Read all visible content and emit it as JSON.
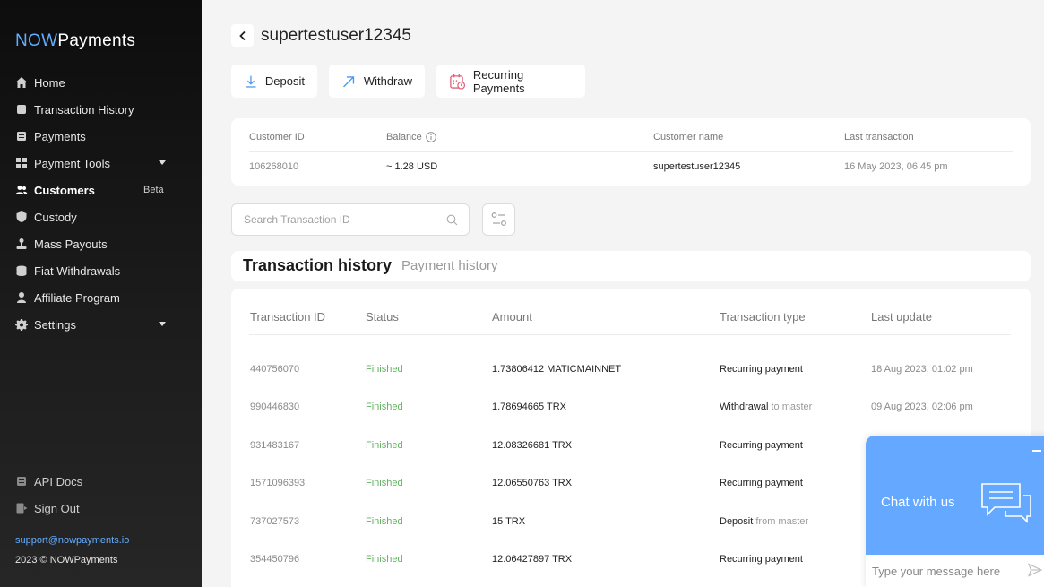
{
  "brand": {
    "prefix": "NOW",
    "suffix": "Payments"
  },
  "sidebar": {
    "items": [
      {
        "label": "Home",
        "icon": "home-icon"
      },
      {
        "label": "Transaction History",
        "icon": "wallet-icon"
      },
      {
        "label": "Payments",
        "icon": "document-icon"
      },
      {
        "label": "Payment Tools",
        "icon": "grid-icon"
      },
      {
        "label": "Customers",
        "icon": "users-icon",
        "badge": "Beta"
      },
      {
        "label": "Custody",
        "icon": "shield-icon"
      },
      {
        "label": "Mass Payouts",
        "icon": "payout-icon"
      },
      {
        "label": "Fiat Withdrawals",
        "icon": "bank-icon"
      },
      {
        "label": "Affiliate Program",
        "icon": "person-icon"
      },
      {
        "label": "Settings",
        "icon": "gear-icon"
      }
    ],
    "bottom": [
      {
        "label": "API Docs",
        "icon": "api-doc-icon"
      },
      {
        "label": "Sign Out",
        "icon": "sign-out-icon"
      }
    ],
    "support_email": "support@nowpayments.io",
    "copyright": "2023 © NOWPayments"
  },
  "header": {
    "title": "supertestuser12345"
  },
  "actions": {
    "deposit": "Deposit",
    "withdraw": "Withdraw",
    "recurring": "Recurring Payments"
  },
  "customer": {
    "headers": {
      "id": "Customer ID",
      "balance": "Balance",
      "name": "Customer name",
      "last": "Last transaction"
    },
    "values": {
      "id": "106268010",
      "balance": "~ 1.28 USD",
      "name": "supertestuser12345",
      "last": "16 May 2023, 06:45 pm"
    }
  },
  "search": {
    "placeholder": "Search Transaction ID",
    "value": ""
  },
  "tabs": {
    "active": "Transaction history",
    "inactive": "Payment history"
  },
  "table": {
    "headers": {
      "id": "Transaction ID",
      "status": "Status",
      "amount": "Amount",
      "type": "Transaction type",
      "date": "Last update"
    },
    "rows": [
      {
        "id": "440756070",
        "status": "Finished",
        "amount": "1.73806412 MATICMAINNET",
        "type": "Recurring payment",
        "type_extra": "",
        "date": "18 Aug 2023, 01:02 pm"
      },
      {
        "id": "990446830",
        "status": "Finished",
        "amount": "1.78694665 TRX",
        "type": "Withdrawal",
        "type_extra": "to master",
        "date": "09 Aug 2023, 02:06 pm"
      },
      {
        "id": "931483167",
        "status": "Finished",
        "amount": "12.08326681 TRX",
        "type": "Recurring payment",
        "type_extra": "",
        "date": ""
      },
      {
        "id": "1571096393",
        "status": "Finished",
        "amount": "12.06550763 TRX",
        "type": "Recurring payment",
        "type_extra": "",
        "date": ""
      },
      {
        "id": "737027573",
        "status": "Finished",
        "amount": "15 TRX",
        "type": "Deposit",
        "type_extra": "from master",
        "date": ""
      },
      {
        "id": "354450796",
        "status": "Finished",
        "amount": "12.06427897 TRX",
        "type": "Recurring payment",
        "type_extra": "",
        "date": ""
      }
    ]
  },
  "chat": {
    "title": "Chat with us",
    "placeholder": "Type your message here"
  },
  "colors": {
    "accent": "#64acff",
    "status_finished": "#5fb25f",
    "chat": "#64a8ff"
  }
}
